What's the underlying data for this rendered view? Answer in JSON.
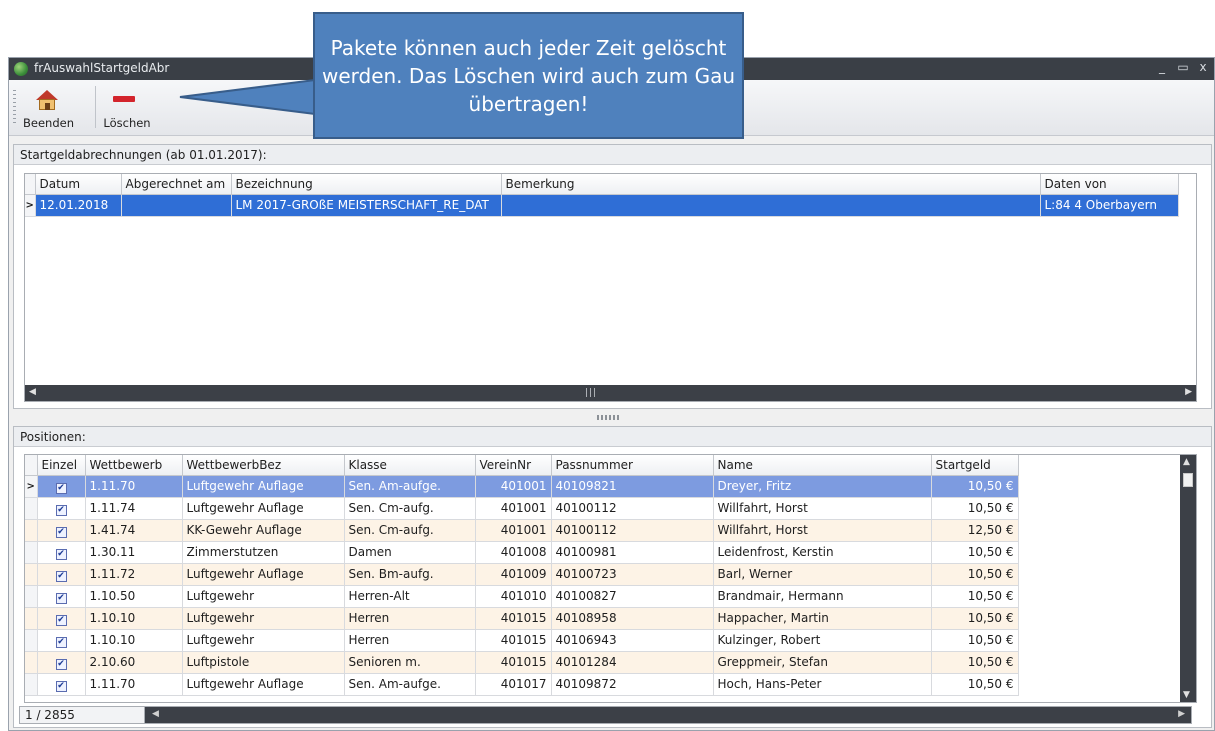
{
  "window": {
    "title": "frAuswahlStartgeldAbr",
    "controls": [
      "_",
      "▭",
      "x"
    ]
  },
  "toolbar": {
    "buttons": [
      {
        "label": "Beenden",
        "icon": "house-icon"
      },
      {
        "label": "Löschen",
        "icon": "minus-icon"
      }
    ]
  },
  "callout": {
    "text": "Pakete können auch jeder Zeit gelöscht werden. Das Löschen wird auch zum Gau übertragen!"
  },
  "top_panel": {
    "title": "Startgeldabrechnungen (ab 01.01.2017):",
    "columns": [
      "Datum",
      "Abgerechnet am",
      "Bezeichnung",
      "Bemerkung",
      "Daten von"
    ],
    "rows": [
      {
        "datum": "12.01.2018",
        "abgerechnet": "",
        "bezeichnung": "LM 2017-GROßE MEISTERSCHAFT_RE_DAT",
        "bemerkung": "",
        "daten_von": "L:84 4 Oberbayern"
      }
    ]
  },
  "bottom_panel": {
    "title": "Positionen:",
    "columns": [
      "Einzel",
      "Wettbewerb",
      "WettbewerbBez",
      "Klasse",
      "VereinNr",
      "Passnummer",
      "Name",
      "Startgeld"
    ],
    "rows": [
      {
        "einzel": true,
        "wettbewerb": "1.11.70",
        "bez": "Luftgewehr Auflage",
        "klasse": "Sen. Am-aufge.",
        "verein": "401001",
        "pass": "40109821",
        "name": "Dreyer, Fritz",
        "startgeld": "10,50 €"
      },
      {
        "einzel": true,
        "wettbewerb": "1.11.74",
        "bez": "Luftgewehr Auflage",
        "klasse": "Sen. Cm-aufg.",
        "verein": "401001",
        "pass": "40100112",
        "name": "Willfahrt, Horst",
        "startgeld": "10,50 €"
      },
      {
        "einzel": true,
        "wettbewerb": "1.41.74",
        "bez": "KK-Gewehr Auflage",
        "klasse": "Sen. Cm-aufg.",
        "verein": "401001",
        "pass": "40100112",
        "name": "Willfahrt, Horst",
        "startgeld": "12,50 €"
      },
      {
        "einzel": true,
        "wettbewerb": "1.30.11",
        "bez": "Zimmerstutzen",
        "klasse": "Damen",
        "verein": "401008",
        "pass": "40100981",
        "name": "Leidenfrost, Kerstin",
        "startgeld": "10,50 €"
      },
      {
        "einzel": true,
        "wettbewerb": "1.11.72",
        "bez": "Luftgewehr Auflage",
        "klasse": "Sen. Bm-aufg.",
        "verein": "401009",
        "pass": "40100723",
        "name": "Barl, Werner",
        "startgeld": "10,50 €"
      },
      {
        "einzel": true,
        "wettbewerb": "1.10.50",
        "bez": "Luftgewehr",
        "klasse": "Herren-Alt",
        "verein": "401010",
        "pass": "40100827",
        "name": "Brandmair, Hermann",
        "startgeld": "10,50 €"
      },
      {
        "einzel": true,
        "wettbewerb": "1.10.10",
        "bez": "Luftgewehr",
        "klasse": "Herren",
        "verein": "401015",
        "pass": "40108958",
        "name": "Happacher, Martin",
        "startgeld": "10,50 €"
      },
      {
        "einzel": true,
        "wettbewerb": "1.10.10",
        "bez": "Luftgewehr",
        "klasse": "Herren",
        "verein": "401015",
        "pass": "40106943",
        "name": "Kulzinger, Robert",
        "startgeld": "10,50 €"
      },
      {
        "einzel": true,
        "wettbewerb": "2.10.60",
        "bez": "Luftpistole",
        "klasse": "Senioren  m.",
        "verein": "401015",
        "pass": "40101284",
        "name": "Greppmeir, Stefan",
        "startgeld": "10,50 €"
      },
      {
        "einzel": true,
        "wettbewerb": "1.11.70",
        "bez": "Luftgewehr Auflage",
        "klasse": "Sen. Am-aufge.",
        "verein": "401017",
        "pass": "40109872",
        "name": "Hoch, Hans-Peter",
        "startgeld": "10,50 €"
      }
    ],
    "record_counter": "1 / 2855"
  },
  "colors": {
    "selection": "#2f6ed6",
    "highlight_row": "#7d9be0",
    "alt_row": "#fdf3e6",
    "callout": "#4f81bd",
    "titlebar": "#3a3f46"
  }
}
